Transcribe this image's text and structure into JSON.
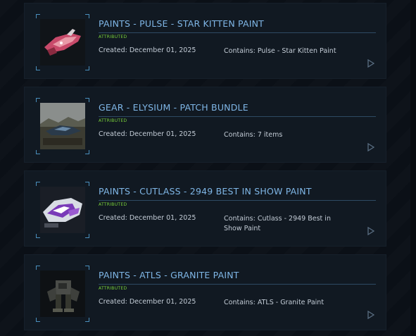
{
  "items": [
    {
      "title": "PAINTS - PULSE - STAR KITTEN PAINT",
      "badge": "ATTRIBUTED",
      "created": "Created: December 01, 2025",
      "contains": "Contains: Pulse - Star Kitten Paint",
      "thumb_icon": "pink-ship-image"
    },
    {
      "title": "GEAR - ELYSIUM - PATCH BUNDLE",
      "badge": "ATTRIBUTED",
      "created": "Created: December 01, 2025",
      "contains": "Contains: 7 items",
      "thumb_icon": "landscape-ship-image"
    },
    {
      "title": "PAINTS - CUTLASS - 2949 BEST IN SHOW PAINT",
      "badge": "ATTRIBUTED",
      "created": "Created: December 01, 2025",
      "contains": "Contains: Cutlass - 2949 Best in Show Paint",
      "thumb_icon": "purple-ship-image"
    },
    {
      "title": "PAINTS - ATLS - GRANITE PAINT",
      "badge": "ATTRIBUTED",
      "created": "Created: December 01, 2025",
      "contains": "Contains: ATLS - Granite Paint",
      "thumb_icon": "mech-suit-image"
    }
  ],
  "colors": {
    "title": "#7fb6e6",
    "badge": "#7ad23a",
    "text": "#c3ccd6",
    "card_bg": "#111922"
  }
}
